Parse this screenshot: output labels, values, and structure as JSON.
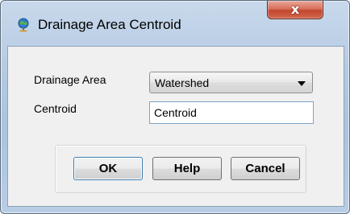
{
  "window": {
    "title": "Drainage Area Centroid",
    "close_label": "x"
  },
  "form": {
    "drainage_area_label": "Drainage Area",
    "drainage_area_value": "Watershed",
    "centroid_label": "Centroid",
    "centroid_value": "Centroid"
  },
  "buttons": {
    "ok": "OK",
    "help": "Help",
    "cancel": "Cancel"
  }
}
